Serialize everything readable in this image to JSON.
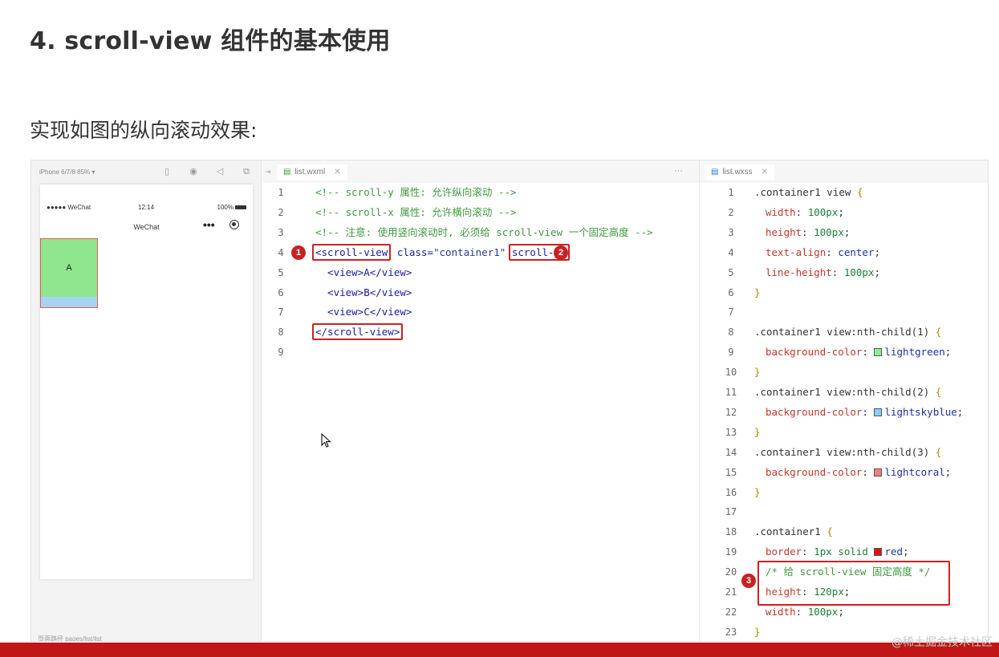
{
  "page_title": "4. scroll-view 组件的基本使用",
  "subtitle": "实现如图的纵向滚动效果:",
  "simulator": {
    "device": "iPhone 6/7/8 85% ▾",
    "signal": "●●●●● WeChat",
    "time": "12:14",
    "battery": "100%",
    "nav_title": "WeChat",
    "nav_dots": "•••",
    "box_a": "A",
    "bottom": "页面路径   pages/list/list"
  },
  "wxml": {
    "tab_label": "list.wxml",
    "tab_more": "···",
    "lines": [
      {
        "n": "1",
        "text": "<!-- scroll-y 属性: 允许纵向滚动 -->"
      },
      {
        "n": "2",
        "text": "<!-- scroll-x 属性: 允许横向滚动 -->"
      },
      {
        "n": "3",
        "text": "<!-- 注意: 使用竖向滚动时, 必须给 scroll-view 一个固定高度 -->"
      },
      {
        "n": "4",
        "open": "<scroll-view",
        "attr": " class=",
        "val": "\"container1\"",
        "attr2": "scroll-y>"
      },
      {
        "n": "5",
        "text": "  <view>A</view>"
      },
      {
        "n": "6",
        "text": "  <view>B</view>"
      },
      {
        "n": "7",
        "text": "  <view>C</view>"
      },
      {
        "n": "8",
        "text": "</scroll-view>"
      },
      {
        "n": "9",
        "text": ""
      }
    ],
    "callouts": [
      "1",
      "2"
    ]
  },
  "wxss": {
    "tab_label": "list.wxss",
    "lines": [
      {
        "n": "1",
        "sel": ".container1 view ",
        "brace": "{"
      },
      {
        "n": "2",
        "prop": "width",
        "num": "100px"
      },
      {
        "n": "3",
        "prop": "height",
        "num": "100px"
      },
      {
        "n": "4",
        "prop": "text-align",
        "val": "center"
      },
      {
        "n": "5",
        "prop": "line-height",
        "num": "100px"
      },
      {
        "n": "6",
        "brace": "}"
      },
      {
        "n": "7"
      },
      {
        "n": "8",
        "sel": ".container1 view:nth-child(1) ",
        "brace": "{"
      },
      {
        "n": "9",
        "prop": "background-color",
        "val": "lightgreen",
        "swatch": "#90ee90"
      },
      {
        "n": "10",
        "brace": "}"
      },
      {
        "n": "11",
        "sel": ".container1 view:nth-child(2) ",
        "brace": "{"
      },
      {
        "n": "12",
        "prop": "background-color",
        "val": "lightskyblue",
        "swatch": "#87cefa"
      },
      {
        "n": "13",
        "brace": "}"
      },
      {
        "n": "14",
        "sel": ".container1 view:nth-child(3) ",
        "brace": "{"
      },
      {
        "n": "15",
        "prop": "background-color",
        "val": "lightcoral",
        "swatch": "#f08080"
      },
      {
        "n": "16",
        "brace": "}"
      },
      {
        "n": "17"
      },
      {
        "n": "18",
        "sel": ".container1 ",
        "brace": "{"
      },
      {
        "n": "19",
        "prop": "border",
        "num": "1px solid",
        "val": "red",
        "swatch": "#dd1111"
      },
      {
        "n": "20",
        "comment": "/* 给 scroll-view 固定高度 */"
      },
      {
        "n": "21",
        "prop": "height",
        "num": "120px"
      },
      {
        "n": "22",
        "prop": "width",
        "num": "100px"
      },
      {
        "n": "23",
        "brace": "}"
      }
    ],
    "callouts": [
      "3"
    ]
  },
  "watermark": "@稀土掘金技术社区",
  "colors": {
    "accent_red": "#c01616",
    "callout": "#c72222"
  }
}
